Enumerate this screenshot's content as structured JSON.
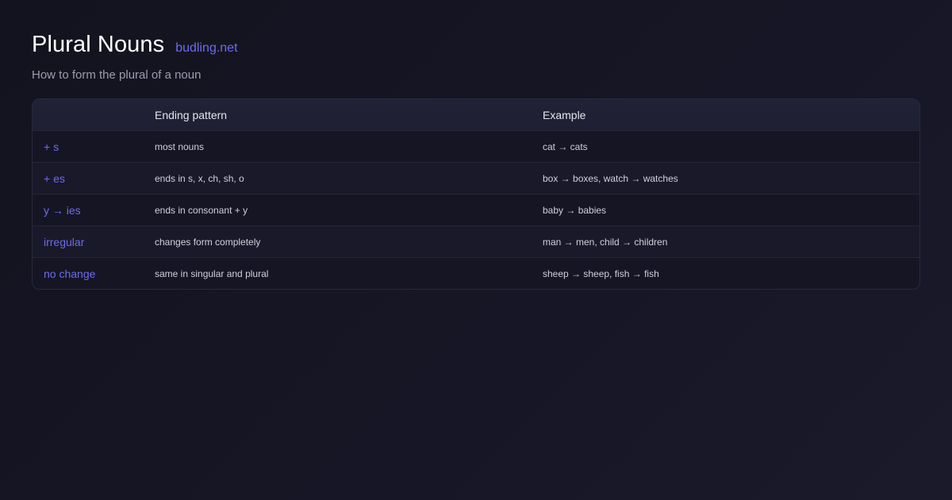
{
  "header": {
    "title": "Plural Nouns",
    "site": "budling.net",
    "subtitle": "How to form the plural of a noun"
  },
  "table": {
    "columns": [
      "",
      "Ending pattern",
      "Example"
    ],
    "rows": [
      {
        "rule": "+ s",
        "pattern": "most nouns",
        "example": "cat → cats"
      },
      {
        "rule": "+ es",
        "pattern": "ends in s, x, ch, sh, o",
        "example": "box → boxes, watch → watches"
      },
      {
        "rule": "y → ies",
        "pattern": "ends in consonant + y",
        "example": "baby → babies"
      },
      {
        "rule": "irregular",
        "pattern": "changes form completely",
        "example": "man → men, child → children"
      },
      {
        "rule": "no change",
        "pattern": "same in singular and plural",
        "example": "sheep → sheep, fish → fish"
      }
    ]
  },
  "colors": {
    "accent": "#6d6cf0",
    "background": "#13131f",
    "header_row": "#20203a"
  }
}
